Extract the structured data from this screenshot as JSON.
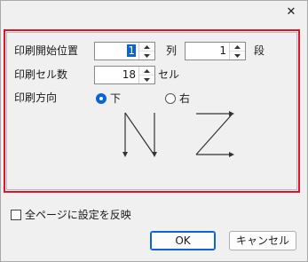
{
  "window": {
    "close_glyph": "✕"
  },
  "settings": {
    "start_position_label": "印刷開始位置",
    "column_value": "1",
    "column_unit": "列",
    "row_value": "1",
    "row_unit": "段",
    "cell_count_label": "印刷セル数",
    "cell_count_value": "18",
    "cell_count_unit": "セル",
    "direction_label": "印刷方向",
    "direction_options": [
      {
        "label": "下",
        "selected": true
      },
      {
        "label": "右",
        "selected": false
      }
    ]
  },
  "footer": {
    "apply_all_pages_label": "全ページに設定を反映",
    "apply_all_pages_checked": false,
    "ok_label": "OK",
    "cancel_label": "キャンセル"
  },
  "colors": {
    "accent": "#0a64d8",
    "highlight_border": "#e0152a"
  }
}
